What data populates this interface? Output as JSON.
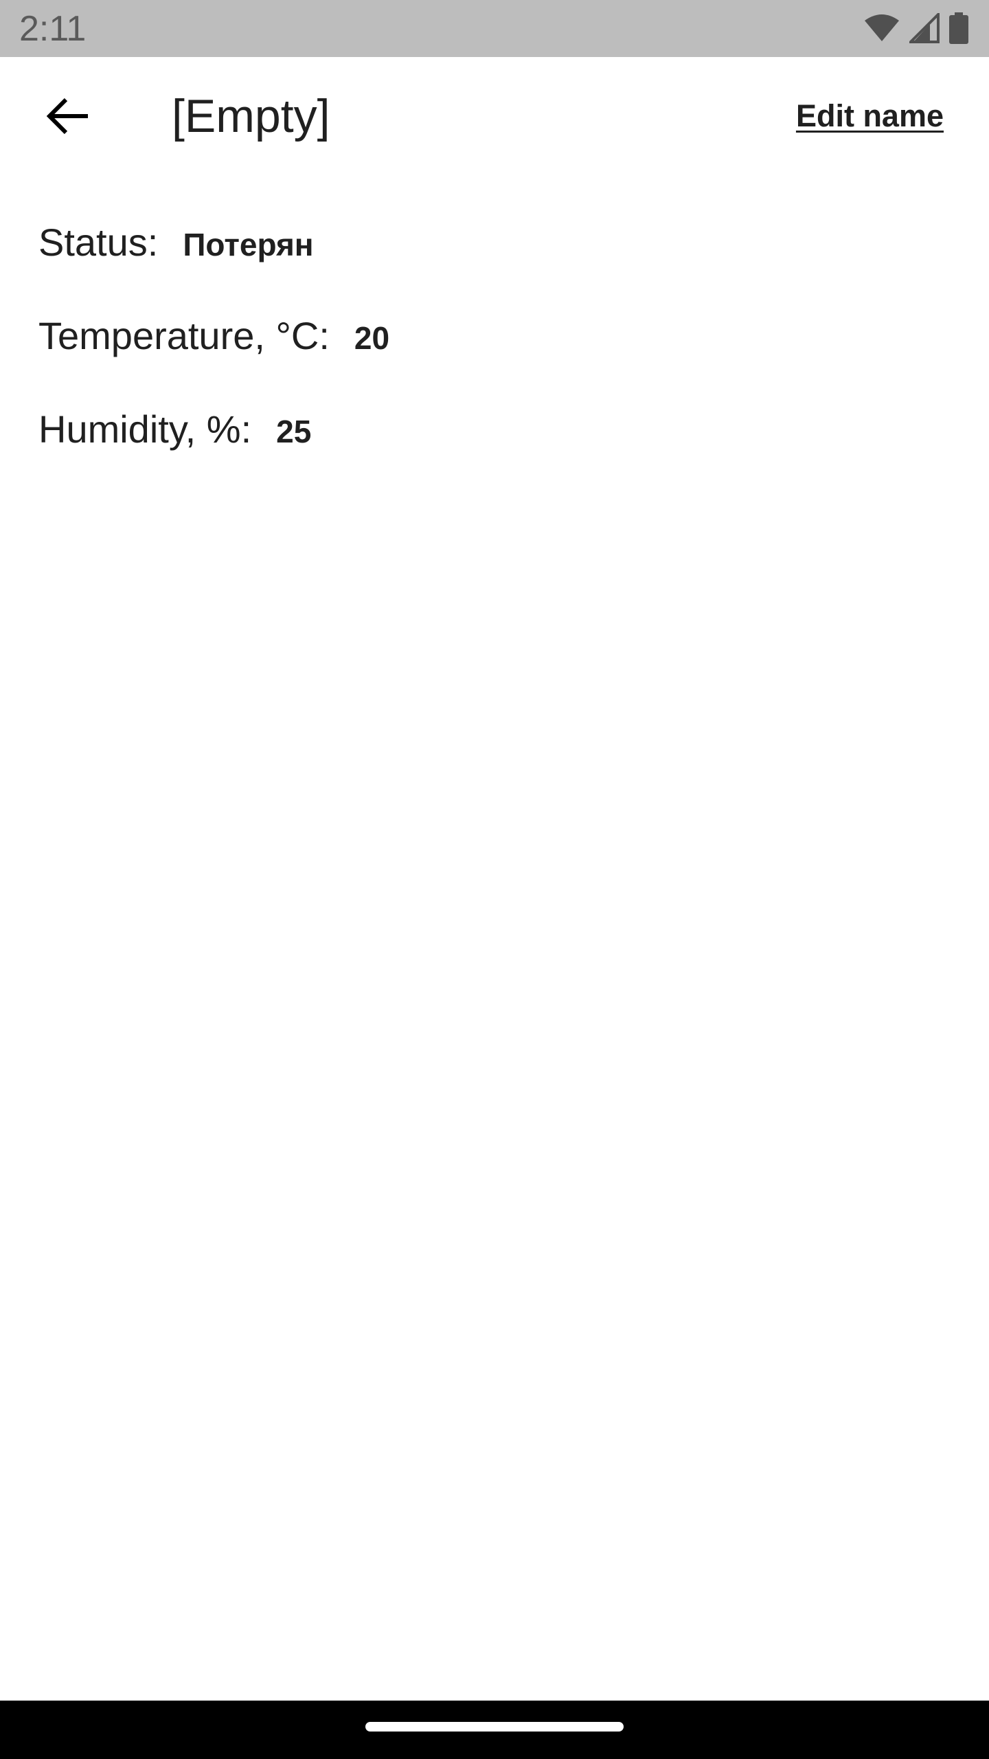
{
  "status_bar": {
    "time": "2:11",
    "icons": [
      "wifi-icon",
      "cell-signal-icon",
      "battery-icon"
    ]
  },
  "app_bar": {
    "back_icon": "arrow-back-icon",
    "title": "[Empty]",
    "edit_label": "Edit name"
  },
  "details": {
    "status_label": "Status:",
    "status_value": "Потерян",
    "temperature_label": "Temperature, °C:",
    "temperature_value": "20",
    "humidity_label": "Humidity, %:",
    "humidity_value": "25"
  },
  "colors": {
    "status_bar_bg": "#bdbdbd",
    "text": "#202020",
    "background": "#ffffff",
    "nav_bar_bg": "#000000"
  }
}
